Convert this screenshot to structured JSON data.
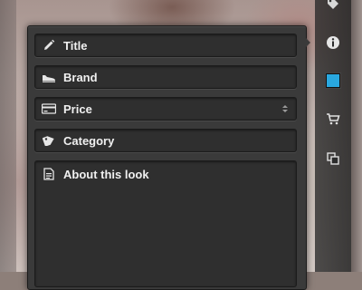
{
  "form": {
    "title_placeholder": "Title",
    "brand_placeholder": "Brand",
    "price_placeholder": "Price",
    "category_placeholder": "Category",
    "about_placeholder": "About this look"
  },
  "toolbar": {
    "tools": [
      "tag-icon",
      "info-icon",
      "color-swatch",
      "cart-icon",
      "duplicate-icon"
    ],
    "swatch_color": "#29a8e0"
  },
  "colors": {
    "panel": "#3a3a3a",
    "field": "#2f2f2f",
    "text": "#f0f0f0",
    "accent": "#29a8e0"
  }
}
